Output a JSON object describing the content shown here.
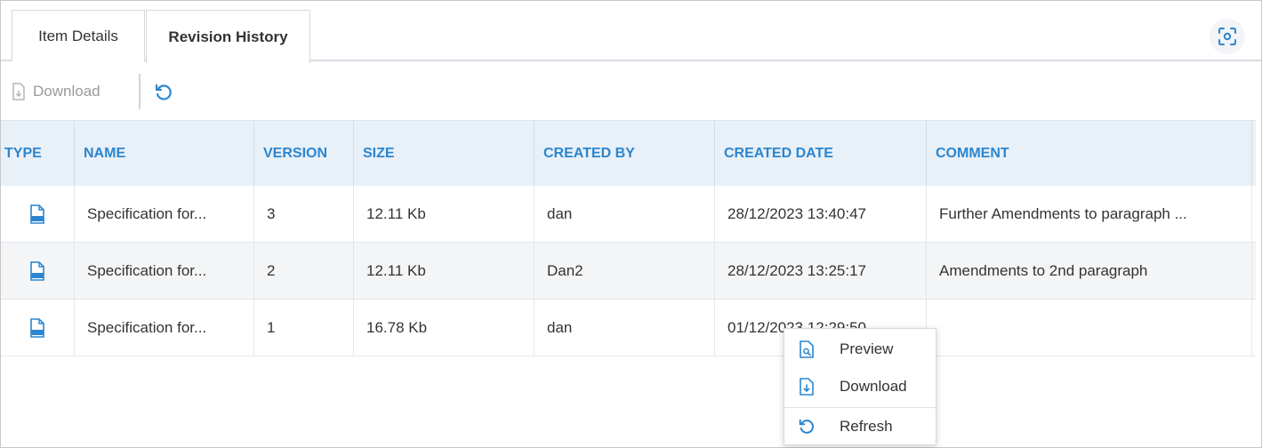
{
  "tabs": [
    {
      "label": "Item Details",
      "active": false
    },
    {
      "label": "Revision History",
      "active": true
    }
  ],
  "toolbar": {
    "download_label": "Download",
    "download_enabled": false,
    "refresh_icon": "refresh-icon"
  },
  "table": {
    "columns": [
      "TYPE",
      "NAME",
      "VERSION",
      "SIZE",
      "CREATED BY",
      "CREATED DATE",
      "COMMENT"
    ],
    "rows": [
      {
        "type_icon": "docx-file-icon",
        "name": "Specification for...",
        "version": "3",
        "size": "12.11 Kb",
        "created_by": "dan",
        "created_date": "28/12/2023 13:40:47",
        "comment": "Further Amendments to paragraph ..."
      },
      {
        "type_icon": "docx-file-icon",
        "name": "Specification for...",
        "version": "2",
        "size": "12.11 Kb",
        "created_by": "Dan2",
        "created_date": "28/12/2023 13:25:17",
        "comment": "Amendments to 2nd paragraph"
      },
      {
        "type_icon": "docx-file-icon",
        "name": "Specification for...",
        "version": "1",
        "size": "16.78 Kb",
        "created_by": "dan",
        "created_date": "01/12/2023 12:29:50",
        "comment": ""
      }
    ]
  },
  "context_menu": {
    "items": [
      {
        "label": "Preview",
        "icon": "preview-icon"
      },
      {
        "label": "Download",
        "icon": "download-icon"
      },
      {
        "label": "Refresh",
        "icon": "refresh-icon"
      }
    ]
  },
  "colors": {
    "accent": "#2b86cf",
    "header_bg": "#e8f0f8",
    "alt_row_bg": "#f4f5f6"
  }
}
